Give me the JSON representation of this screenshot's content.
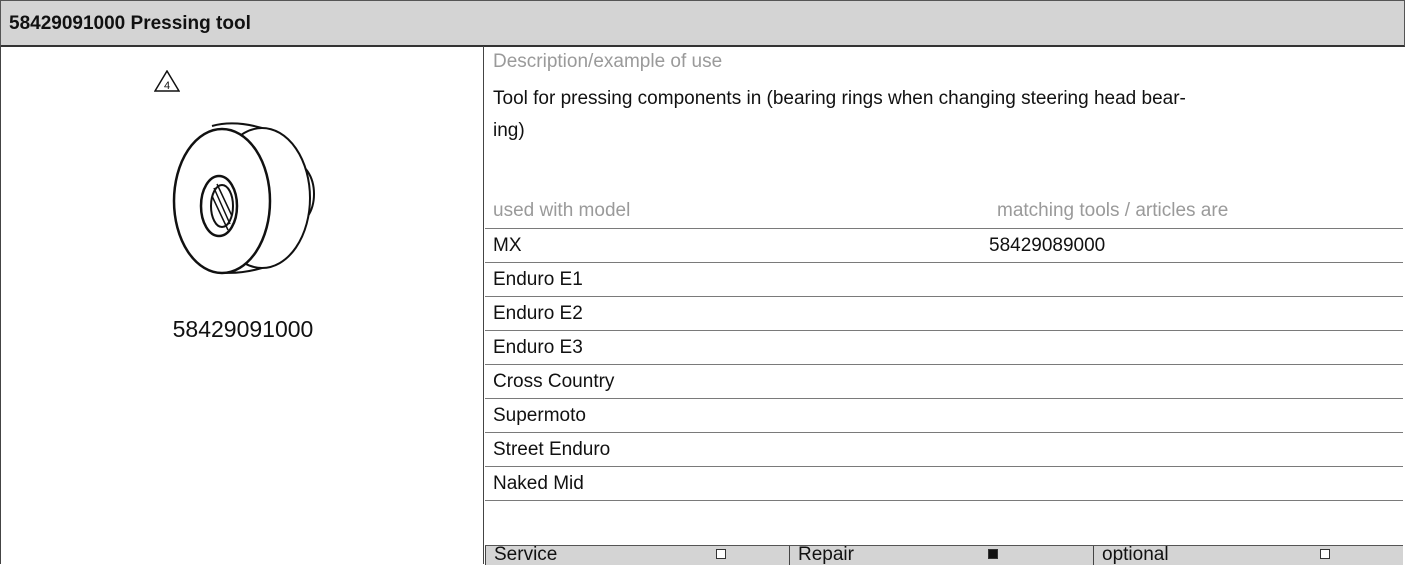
{
  "header": {
    "title": "58429091000 Pressing tool"
  },
  "image": {
    "warning_number": "4",
    "part_number": "58429091000",
    "icon": "pressing-tool-drawing"
  },
  "description": {
    "label": "Description/example of use",
    "text_line1": "Tool for pressing components in (bearing rings when changing steering head bear-",
    "text_line2": "ing)"
  },
  "used_with": {
    "label": "used with model",
    "models": [
      "MX",
      "Enduro E1",
      "Enduro E2",
      "Enduro E3",
      "Cross Country",
      "Supermoto",
      "Street Enduro",
      "Naked Mid"
    ]
  },
  "matching": {
    "label": "matching tools / articles are",
    "items": [
      "58429089000"
    ]
  },
  "status": [
    {
      "label": "Service",
      "checked": false
    },
    {
      "label": "Repair",
      "checked": true
    },
    {
      "label": "optional",
      "checked": false
    }
  ]
}
